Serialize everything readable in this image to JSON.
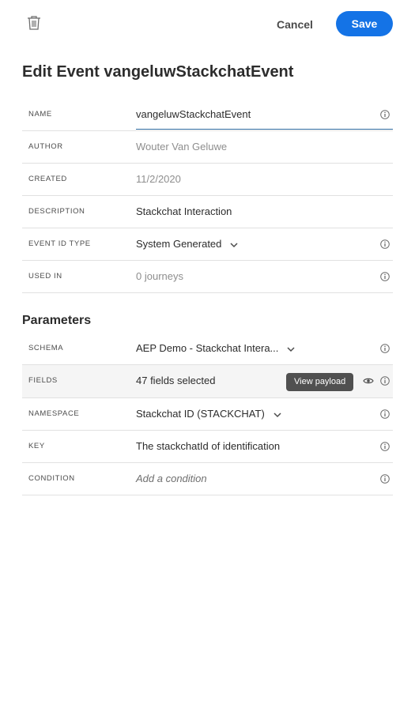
{
  "toolbar": {
    "delete_icon": "trash-icon",
    "cancel_label": "Cancel",
    "save_label": "Save",
    "accent_color": "#1473e6"
  },
  "page": {
    "title": "Edit Event vangeluwStackchatEvent"
  },
  "properties": {
    "name": {
      "label": "NAME",
      "value": "vangeluwStackchatEvent"
    },
    "author": {
      "label": "AUTHOR",
      "value": "Wouter Van Geluwe"
    },
    "created": {
      "label": "CREATED",
      "value": "11/2/2020"
    },
    "description": {
      "label": "DESCRIPTION",
      "value": "Stackchat Interaction"
    },
    "event_id_type": {
      "label": "EVENT ID TYPE",
      "value": "System Generated"
    },
    "used_in": {
      "label": "USED IN",
      "value": "0 journeys"
    }
  },
  "parameters": {
    "title": "Parameters",
    "schema": {
      "label": "SCHEMA",
      "value": "AEP Demo - Stackchat Intera..."
    },
    "fields": {
      "label": "FIELDS",
      "value": "47 fields selected",
      "tooltip": "View payload"
    },
    "namespace": {
      "label": "NAMESPACE",
      "value": "Stackchat ID (STACKCHAT)"
    },
    "key": {
      "label": "KEY",
      "value": "The stackchatId of identification"
    },
    "condition": {
      "label": "CONDITION",
      "placeholder": "Add a condition"
    }
  }
}
